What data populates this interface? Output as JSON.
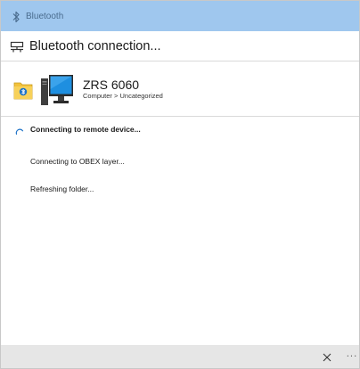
{
  "titlebar": {
    "title": "Bluetooth",
    "icon": "bluetooth-icon",
    "background": "#9fc7ee"
  },
  "header": {
    "title": "Bluetooth connection...",
    "icon": "network-connection-icon"
  },
  "device": {
    "name": "ZRS 6060",
    "category": "Computer > Uncategorized",
    "folder_icon": "bluetooth-folder-icon",
    "device_icon": "computer-icon"
  },
  "steps": [
    {
      "label": "Connecting to remote device...",
      "active": true
    },
    {
      "label": "Connecting to OBEX layer...",
      "active": false
    },
    {
      "label": "Refreshing folder...",
      "active": false
    }
  ],
  "footer": {
    "close_icon": "close-icon",
    "more_label": "···",
    "background": "#e6e6e6"
  },
  "colors": {
    "accent": "#1e73c8",
    "divider": "#d9d9d9"
  }
}
